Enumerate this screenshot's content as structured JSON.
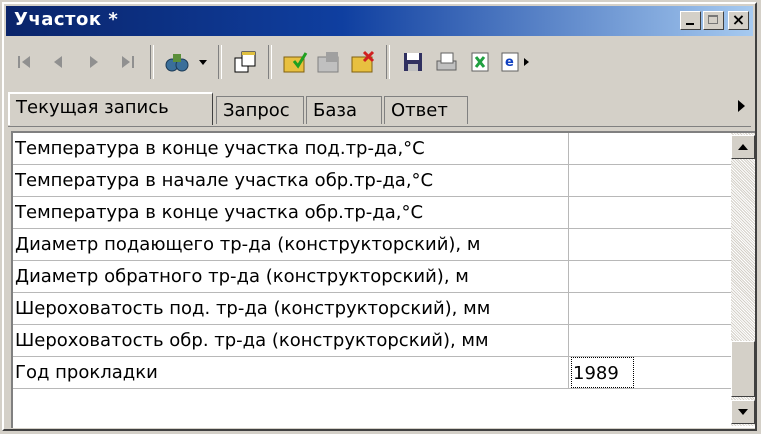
{
  "window": {
    "title": "Участок *"
  },
  "toolbar": {
    "icons": [
      "first-record-icon",
      "prev-record-icon",
      "next-record-icon",
      "last-record-icon",
      "binoculars-icon",
      "dropdown-arrow-icon",
      "copy-icon",
      "edit-folder-icon",
      "properties-icon",
      "delete-folder-icon",
      "save-icon",
      "print-icon",
      "export-excel-icon",
      "export-word-icon"
    ]
  },
  "tabs": [
    {
      "label": "Текущая запись",
      "active": true
    },
    {
      "label": "Запрос",
      "active": false
    },
    {
      "label": "База",
      "active": false
    },
    {
      "label": "Ответ",
      "active": false
    }
  ],
  "grid": {
    "rows": [
      {
        "label": "Температура в конце участка под.тр-да,°С",
        "value": ""
      },
      {
        "label": "Температура в начале участка обр.тр-да,°С",
        "value": ""
      },
      {
        "label": "Температура в конце участка обр.тр-да,°С",
        "value": ""
      },
      {
        "label": "Диаметр подающего тр-да (конструкторский), м",
        "value": ""
      },
      {
        "label": "Диаметр обратного тр-да (конструкторский), м",
        "value": ""
      },
      {
        "label": "Шероховатость под. тр-да (конструкторский), мм",
        "value": ""
      },
      {
        "label": "Шероховатость обр. тр-да (конструкторский), мм",
        "value": ""
      },
      {
        "label": "Год прокладки",
        "value": "1989"
      }
    ]
  },
  "colors": {
    "titlebar_start": "#0a246a",
    "titlebar_end": "#a6caf0",
    "face": "#d4d0c8"
  }
}
